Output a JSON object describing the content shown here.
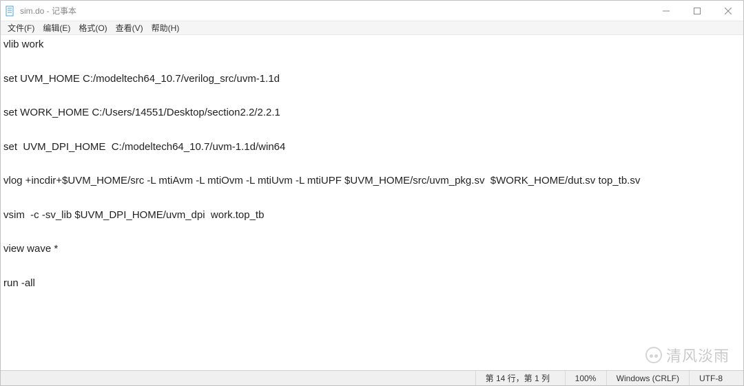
{
  "window": {
    "title": "sim.do - 记事本"
  },
  "menu": {
    "file": "文件(F)",
    "edit": "编辑(E)",
    "format": "格式(O)",
    "view": "查看(V)",
    "help": "帮助(H)"
  },
  "editor": {
    "content": "vlib work\n\nset UVM_HOME C:/modeltech64_10.7/verilog_src/uvm-1.1d\n\nset WORK_HOME C:/Users/14551/Desktop/section2.2/2.2.1\n\nset  UVM_DPI_HOME  C:/modeltech64_10.7/uvm-1.1d/win64\n\nvlog +incdir+$UVM_HOME/src -L mtiAvm -L mtiOvm -L mtiUvm -L mtiUPF $UVM_HOME/src/uvm_pkg.sv  $WORK_HOME/dut.sv top_tb.sv\n\nvsim  -c -sv_lib $UVM_DPI_HOME/uvm_dpi  work.top_tb\n\nview wave *\n\nrun -all"
  },
  "status": {
    "position": "第 14 行，第 1 列",
    "zoom": "100%",
    "eol": "Windows (CRLF)",
    "encoding": "UTF-8"
  },
  "watermark": {
    "text": "清风淡雨"
  }
}
